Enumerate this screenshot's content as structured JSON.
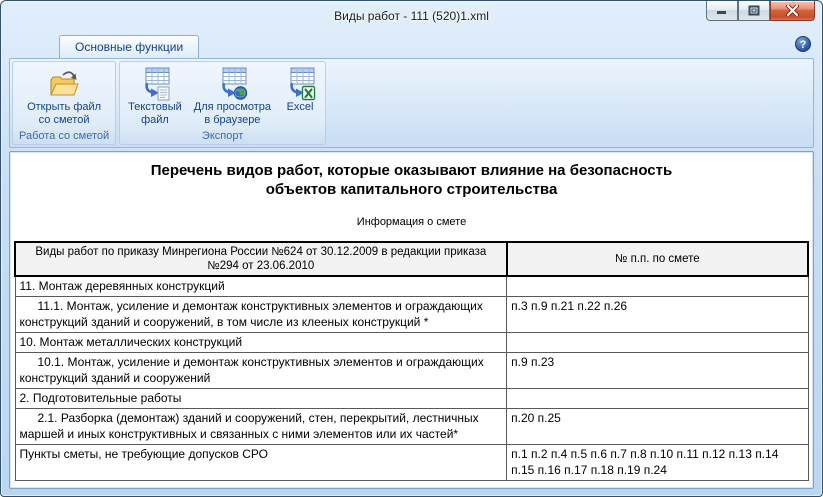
{
  "window": {
    "title": "Виды работ - 111 (520)1.xml",
    "controls": [
      {
        "name": "minimize"
      },
      {
        "name": "maximize"
      },
      {
        "name": "close"
      }
    ]
  },
  "ribbon": {
    "active_tab": "Основные функции",
    "help_glyph": "?",
    "groups": [
      {
        "label": "Работа со сметой",
        "buttons": [
          {
            "line1": "Открыть файл",
            "line2": "со сметой",
            "icon": "open-file-icon"
          }
        ]
      },
      {
        "label": "Экспорт",
        "buttons": [
          {
            "line1": "Текстовый",
            "line2": "файл",
            "icon": "export-text-file-icon"
          },
          {
            "line1": "Для просмотра",
            "line2": "в браузере",
            "icon": "export-browser-icon"
          },
          {
            "line1": "Excel",
            "line2": "",
            "icon": "export-excel-icon"
          }
        ]
      }
    ]
  },
  "document": {
    "title_line1": "Перечень видов работ, которые оказывают влияние на безопасность",
    "title_line2": "объектов капитального строительства",
    "subtitle": "Информация о смете",
    "table": {
      "headers": [
        "Виды работ по приказу Минрегиона России №624 от 30.12.2009 в редакции приказа №294 от 23.06.2010",
        "№ п.п. по смете"
      ],
      "rows": [
        {
          "work": "11. Монтаж деревянных конструкций",
          "items": "",
          "indent": false
        },
        {
          "work": "11.1. Монтаж, усиление и демонтаж конструктивных элементов и ограждающих конструкций зданий и сооружений, в том числе из клееных конструкций *",
          "items": "п.3 п.9 п.21 п.22 п.26",
          "indent": true
        },
        {
          "work": "10. Монтаж металлических конструкций",
          "items": "",
          "indent": false
        },
        {
          "work": "10.1. Монтаж, усиление и демонтаж конструктивных элементов и ограждающих конструкций зданий и сооружений",
          "items": "п.9 п.23",
          "indent": true
        },
        {
          "work": "2. Подготовительные работы",
          "items": "",
          "indent": false
        },
        {
          "work": "2.1. Разборка (демонтаж) зданий и сооружений, стен, перекрытий, лестничных маршей и иных конструктивных и связанных с ними элементов или их частей*",
          "items": "п.20 п.25",
          "indent": true
        },
        {
          "work": "Пункты сметы, не требующие допусков СРО",
          "items": "п.1 п.2 п.4 п.5 п.6 п.7 п.8 п.10 п.11 п.12 п.13 п.14 п.15 п.16 п.17 п.18 п.19 п.24",
          "indent": false
        }
      ]
    }
  },
  "colors": {
    "accent_navy": "#15428b",
    "titlebar_blue": "#c9def2",
    "close_red": "#cf5b3d",
    "folder_yellow": "#fbe29a",
    "excel_green": "#1f7a3d",
    "table_header_bg": "#f2f2f2"
  }
}
